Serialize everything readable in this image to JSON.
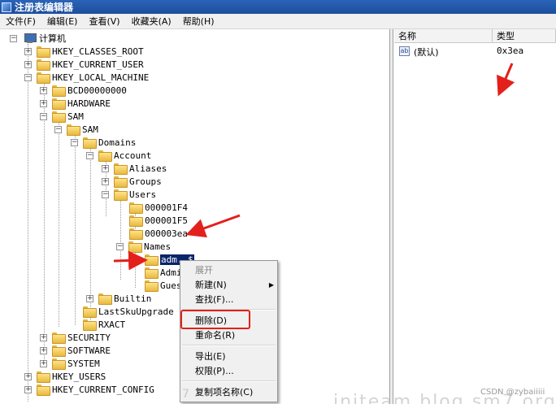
{
  "window": {
    "title": "注册表编辑器"
  },
  "menu": [
    "文件(F)",
    "编辑(E)",
    "查看(V)",
    "收藏夹(A)",
    "帮助(H)"
  ],
  "tree": {
    "root": "计算机",
    "nodes": [
      "HKEY_CLASSES_ROOT",
      "HKEY_CURRENT_USER",
      "HKEY_LOCAL_MACHINE",
      "BCD00000000",
      "HARDWARE",
      "SAM",
      "SAM",
      "Domains",
      "Account",
      "Aliases",
      "Groups",
      "Users",
      "000001F4",
      "000001F5",
      "000003ea",
      "Names",
      "admin$",
      "Admi",
      "Gues",
      "Builtin",
      "LastSkuUpgrade",
      "RXACT",
      "SECURITY",
      "SOFTWARE",
      "SYSTEM",
      "HKEY_USERS",
      "HKEY_CURRENT_CONFIG"
    ],
    "selected": "admin$",
    "selected_display": "adm..$"
  },
  "values_pane": {
    "columns": [
      "名称",
      "类型"
    ],
    "rows": [
      {
        "name": "(默认)",
        "type": "0x3ea"
      }
    ]
  },
  "context_menu": {
    "items": [
      "展开",
      "新建(N)",
      "查找(F)...",
      "删除(D)",
      "重命名(R)",
      "导出(E)",
      "权限(P)...",
      "复制项名称(C)"
    ],
    "highlighted": "删除(D)"
  },
  "watermarks": {
    "bottom": "initeam blog sm7.org",
    "csdn": "CSDN @zybaiiiii",
    "fragment": "7"
  },
  "colors": {
    "annotation_red": "#e3201b",
    "selection": "#0a246a",
    "titlebar": "#1c4e9c"
  }
}
